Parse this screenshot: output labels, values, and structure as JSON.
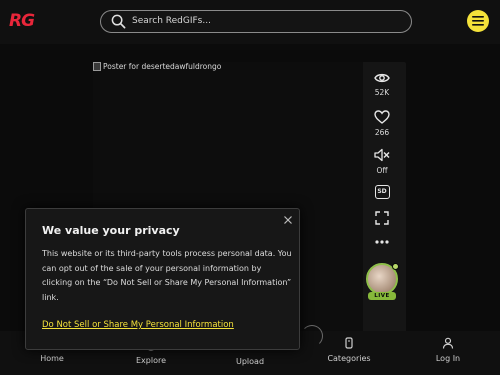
{
  "header": {
    "logo": "RG",
    "search_placeholder": "Search RedGIFs..."
  },
  "video": {
    "poster_alt": "Poster for desertedawfuldrongo"
  },
  "actions": {
    "views_count": "52K",
    "likes_count": "266",
    "sound_label": "Off",
    "quality_label": "SD"
  },
  "creator": {
    "live_badge": "LIVE"
  },
  "bottom_nav": {
    "items": [
      {
        "label": "Home",
        "icon": "home-icon"
      },
      {
        "label": "Explore",
        "icon": "explore-icon"
      },
      {
        "label": "Upload",
        "icon": "upload-icon"
      },
      {
        "label": "Categories",
        "icon": "categories-icon"
      },
      {
        "label": "Log In",
        "icon": "user-icon"
      }
    ]
  },
  "privacy_modal": {
    "title": "We value your privacy",
    "body": "This website or its third-party tools process personal data. You can opt out of the sale of your personal information by clicking on the “Do Not Sell or Share My Personal Information” link.",
    "link": "Do Not Sell or Share My Personal Information"
  },
  "colors": {
    "brand_red": "#e8263a",
    "accent_yellow": "#f4e23a",
    "live_green": "#86b83a"
  }
}
